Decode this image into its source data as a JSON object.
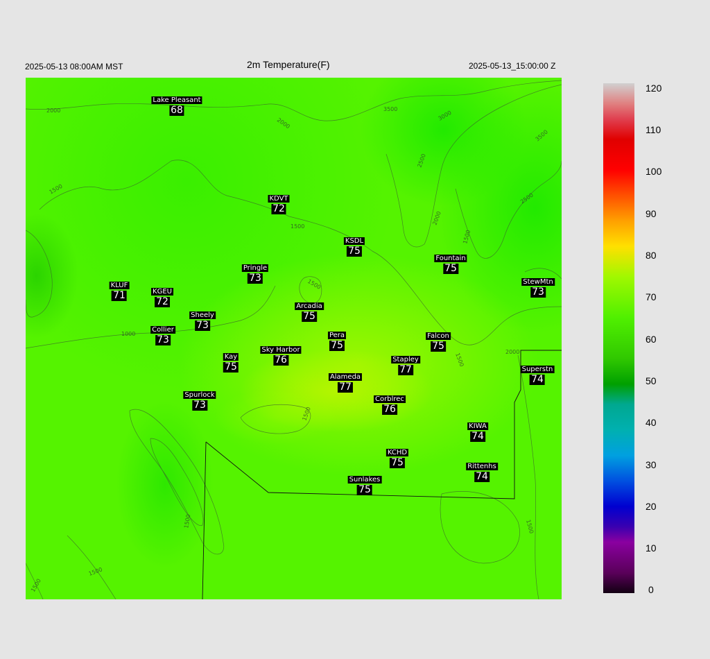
{
  "header": {
    "left_time": "2025-05-13 08:00AM MST",
    "title": "2m Temperature(F)",
    "right_time": "2025-05-13_15:00:00 Z"
  },
  "contour_labels": [
    "2000",
    "2000",
    "3500",
    "3000",
    "2500",
    "3500",
    "2500",
    "2000",
    "1500",
    "1500",
    "1500",
    "1500",
    "1000",
    "1500",
    "2000",
    "1500",
    "1500",
    "1500",
    "1500",
    "1500"
  ],
  "stations": [
    {
      "name": "Lake Pleasant",
      "temp": "68"
    },
    {
      "name": "KDVT",
      "temp": "72"
    },
    {
      "name": "KSDL",
      "temp": "75"
    },
    {
      "name": "Fountain",
      "temp": "75"
    },
    {
      "name": "StewMtn",
      "temp": "73"
    },
    {
      "name": "Pringle",
      "temp": "73"
    },
    {
      "name": "KLUF",
      "temp": "71"
    },
    {
      "name": "KGEU",
      "temp": "72"
    },
    {
      "name": "Arcadia",
      "temp": "75"
    },
    {
      "name": "Sheely",
      "temp": "73"
    },
    {
      "name": "Collier",
      "temp": "73"
    },
    {
      "name": "Pera",
      "temp": "75"
    },
    {
      "name": "Falcon",
      "temp": "75"
    },
    {
      "name": "Kay",
      "temp": "75"
    },
    {
      "name": "Sky Harbor",
      "temp": "76"
    },
    {
      "name": "Stapley",
      "temp": "77"
    },
    {
      "name": "Superstn",
      "temp": "74"
    },
    {
      "name": "Alameda",
      "temp": "77"
    },
    {
      "name": "Spurlock",
      "temp": "73"
    },
    {
      "name": "Corblrec",
      "temp": "76"
    },
    {
      "name": "KIWA",
      "temp": "74"
    },
    {
      "name": "KCHD",
      "temp": "75"
    },
    {
      "name": "Rittenhs",
      "temp": "74"
    },
    {
      "name": "Sunlakes",
      "temp": "75"
    }
  ],
  "colorbar": {
    "ticks": [
      "120",
      "110",
      "100",
      "90",
      "80",
      "70",
      "60",
      "50",
      "40",
      "30",
      "20",
      "10",
      "0"
    ]
  }
}
